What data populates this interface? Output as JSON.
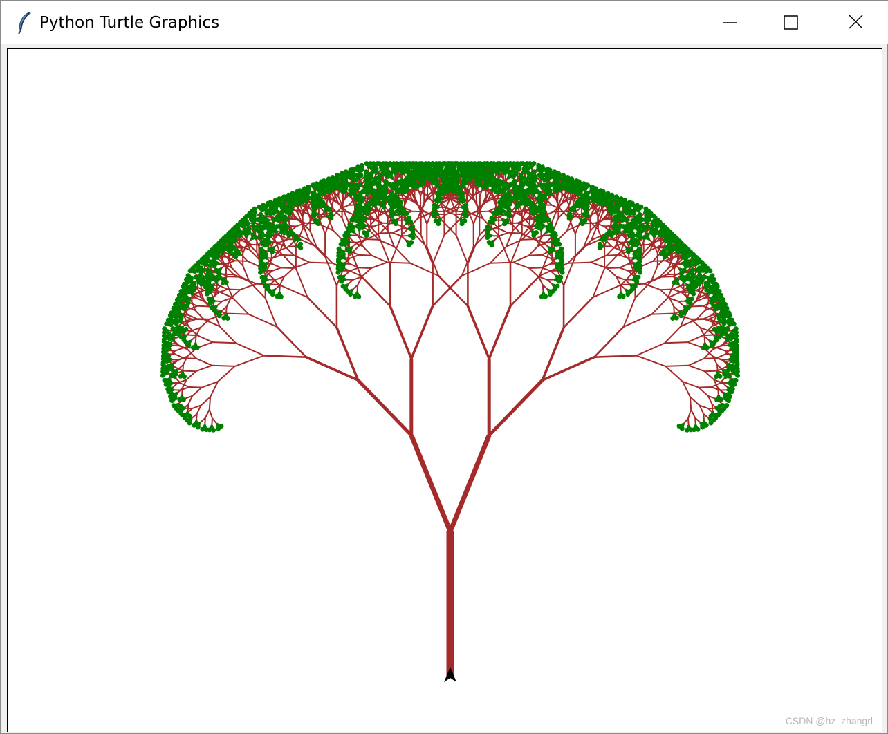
{
  "window": {
    "title": "Python Turtle Graphics",
    "app_icon": "feather-icon",
    "controls": {
      "minimize_icon": "minimize-icon",
      "maximize_icon": "maximize-icon",
      "close_icon": "close-icon"
    }
  },
  "canvas": {
    "background": "#ffffff",
    "drawing": "fractal-tree",
    "trunk_color": "#a52a2a",
    "leaf_color": "#008000",
    "turtle_icon": "turtle-arrow-icon",
    "turtle_color": "#000000"
  },
  "watermark": {
    "text": "CSDN @hz_zhangrl"
  }
}
